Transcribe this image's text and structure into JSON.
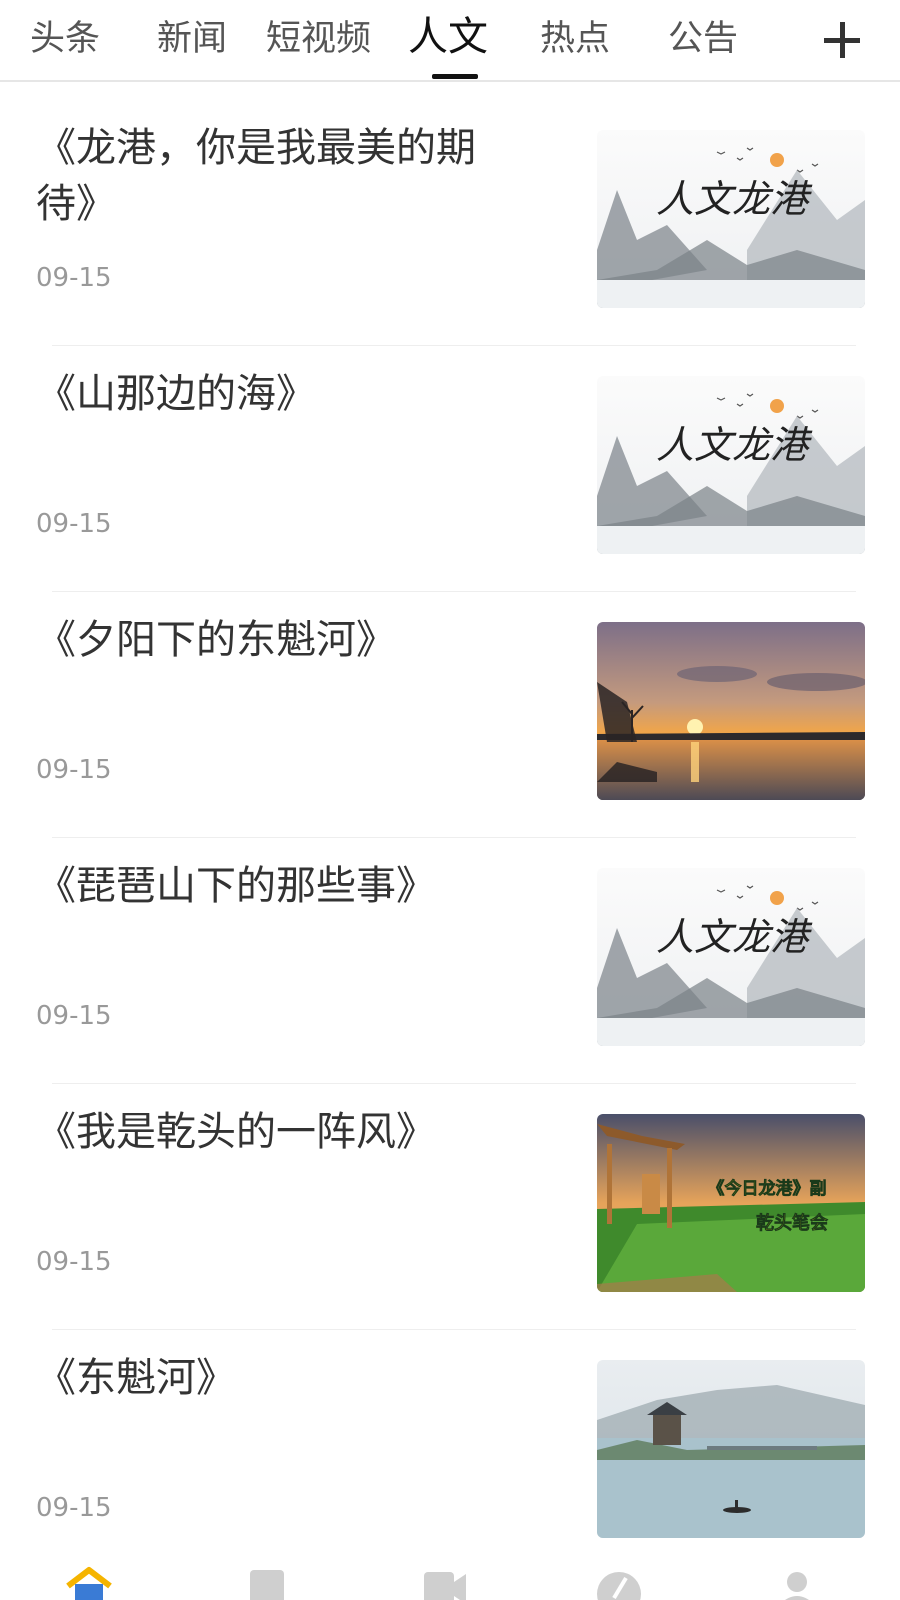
{
  "tabs": [
    {
      "label": "头条",
      "active": false
    },
    {
      "label": "新闻",
      "active": false
    },
    {
      "label": "短视频",
      "active": false
    },
    {
      "label": "人文",
      "active": true
    },
    {
      "label": "热点",
      "active": false
    },
    {
      "label": "公告",
      "active": false
    }
  ],
  "articles": [
    {
      "title": "《龙港，你是我最美的期待》",
      "date": "09-15",
      "thumb": "ink-mountains",
      "thumb_text": "人文龙港"
    },
    {
      "title": "《山那边的海》",
      "date": "09-15",
      "thumb": "ink-mountains",
      "thumb_text": "人文龙港"
    },
    {
      "title": "《夕阳下的东魁河》",
      "date": "09-15",
      "thumb": "sunset-river"
    },
    {
      "title": "《琵琶山下的那些事》",
      "date": "09-15",
      "thumb": "ink-mountains",
      "thumb_text": "人文龙港"
    },
    {
      "title": "《我是乾头的一阵风》",
      "date": "09-15",
      "thumb": "garden-pavilion",
      "thumb_text": "《今日龙港》副",
      "thumb_subtext": "乾头笔会"
    },
    {
      "title": "《东魁河》",
      "date": "09-15",
      "thumb": "pavilion-river"
    }
  ],
  "bottom_nav": [
    {
      "icon": "home-icon",
      "active": true
    },
    {
      "icon": "book-icon",
      "active": false
    },
    {
      "icon": "video-icon",
      "active": false
    },
    {
      "icon": "compass-icon",
      "active": false
    },
    {
      "icon": "user-icon",
      "active": false
    }
  ],
  "colors": {
    "accent": "#f5b400",
    "home_blue": "#3a7bd5",
    "text": "#333333",
    "muted": "#999999"
  }
}
